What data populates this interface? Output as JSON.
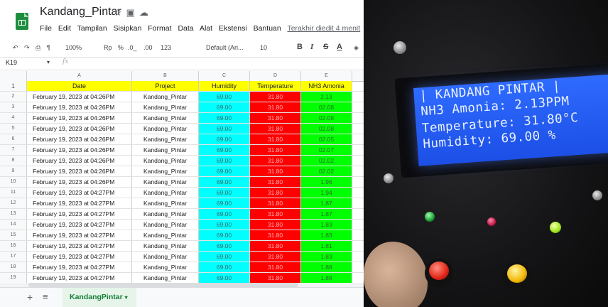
{
  "app": {
    "doc_title": "Kandang_Pintar",
    "menu": [
      "File",
      "Edit",
      "Tampilan",
      "Sisipkan",
      "Format",
      "Data",
      "Alat",
      "Ekstensi",
      "Bantuan"
    ],
    "last_edit": "Terakhir diedit 4 menit"
  },
  "toolbar": {
    "zoom": "100%",
    "currency": "Rp",
    "percent": "%",
    "dec_less": ".0_",
    "dec_more": ".00",
    "format_123": "123",
    "font": "Default (Ari...",
    "font_size": "10",
    "bold": "B",
    "italic": "I",
    "strike": "S",
    "text_color": "A"
  },
  "formula_bar": {
    "cell_ref": "K19",
    "fx": "fx"
  },
  "grid": {
    "columns": [
      "A",
      "B",
      "C",
      "D",
      "E"
    ],
    "headers": [
      "Date",
      "Project",
      "Humidity",
      "Temperature",
      "NH3 Amonia"
    ],
    "rows": [
      [
        "February 19, 2023 at 04:26PM",
        "Kandang_Pintar",
        "69.00",
        "31.80",
        "2.13"
      ],
      [
        "February 19, 2023 at 04:26PM",
        "Kandang_Pintar",
        "69.00",
        "31.80",
        "02.08"
      ],
      [
        "February 19, 2023 at 04:26PM",
        "Kandang_Pintar",
        "69.00",
        "31.80",
        "02.08"
      ],
      [
        "February 19, 2023 at 04:26PM",
        "Kandang_Pintar",
        "69.00",
        "31.80",
        "02.08"
      ],
      [
        "February 19, 2023 at 04:26PM",
        "Kandang_Pintar",
        "69.00",
        "31.80",
        "02.05"
      ],
      [
        "February 19, 2023 at 04:26PM",
        "Kandang_Pintar",
        "69.00",
        "31.80",
        "02.07"
      ],
      [
        "February 19, 2023 at 04:26PM",
        "Kandang_Pintar",
        "69.00",
        "31.80",
        "02.02"
      ],
      [
        "February 19, 2023 at 04:26PM",
        "Kandang_Pintar",
        "69.00",
        "31.80",
        "02.02"
      ],
      [
        "February 19, 2023 at 04:26PM",
        "Kandang_Pintar",
        "69.00",
        "31.80",
        "1.96"
      ],
      [
        "February 19, 2023 at 04:27PM",
        "Kandang_Pintar",
        "69.00",
        "31.80",
        "1.94"
      ],
      [
        "February 19, 2023 at 04:27PM",
        "Kandang_Pintar",
        "69.00",
        "31.80",
        "1.87"
      ],
      [
        "February 19, 2023 at 04:27PM",
        "Kandang_Pintar",
        "69.00",
        "31.80",
        "1.87"
      ],
      [
        "February 19, 2023 at 04:27PM",
        "Kandang_Pintar",
        "69.00",
        "31.80",
        "1.83"
      ],
      [
        "February 19, 2023 at 04:27PM",
        "Kandang_Pintar",
        "69.00",
        "31.80",
        "1.83"
      ],
      [
        "February 19, 2023 at 04:27PM",
        "Kandang_Pintar",
        "69.00",
        "31.80",
        "1.81"
      ],
      [
        "February 19, 2023 at 04:27PM",
        "Kandang_Pintar",
        "69.00",
        "31.80",
        "1.83"
      ],
      [
        "February 19, 2023 at 04:27PM",
        "Kandang_Pintar",
        "69.00",
        "31.80",
        "1.88"
      ],
      [
        "February 19, 2023 at 04:27PM",
        "Kandang_Pintar",
        "69.00",
        "31.80",
        "1.88"
      ]
    ]
  },
  "sheet_tab": {
    "name": "KandangPintar"
  },
  "lcd": {
    "line1": "| KANDANG PINTAR |",
    "line2": "NH3 Amonia: 2.13PPM",
    "line3": "Temperature: 31.80°C",
    "line4": "Humidity: 69.00 %"
  },
  "colors": {
    "header_fill": "#ffff00",
    "humidity_fill": "#00ffff",
    "temperature_fill": "#ff0000",
    "nh3_fill": "#00ff00",
    "lcd_blue": "#2f6bff"
  }
}
